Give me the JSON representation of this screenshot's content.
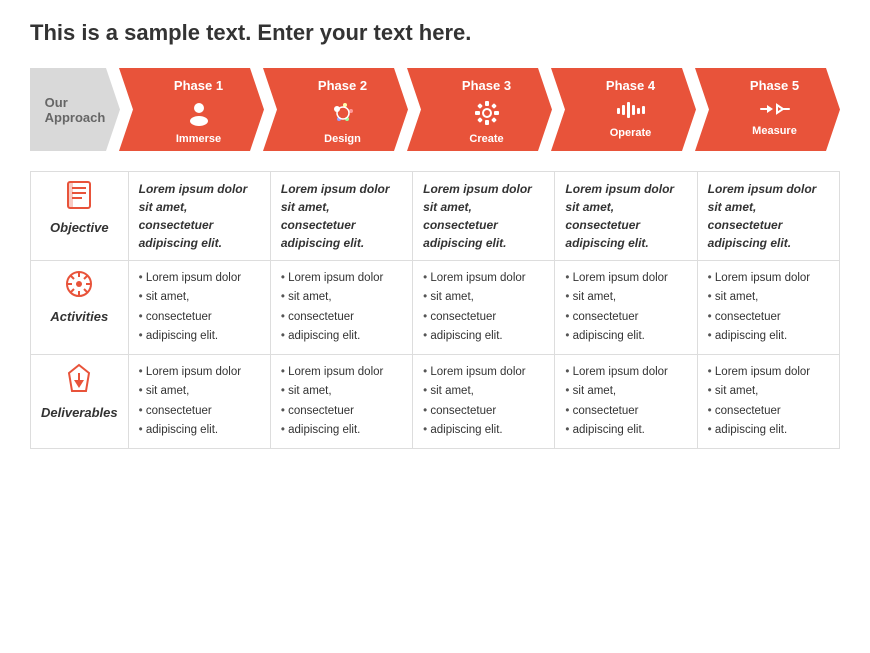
{
  "title": "This is a sample text. Enter your text here.",
  "approach_label": "Our\nApproach",
  "phases": [
    {
      "name": "Phase 1",
      "icon": "👤",
      "sub": "Immerse"
    },
    {
      "name": "Phase 2",
      "icon": "🎨",
      "sub": "Design"
    },
    {
      "name": "Phase 3",
      "icon": "⚙",
      "sub": "Create"
    },
    {
      "name": "Phase 4",
      "icon": "📊",
      "sub": "Operate"
    },
    {
      "name": "Phase 5",
      "icon": "⟺",
      "sub": "Measure"
    }
  ],
  "rows": [
    {
      "label": "Objective",
      "icon_char": "📋",
      "type": "objective",
      "cells": [
        "Lorem ipsum dolor sit amet, consectetuer adipiscing elit.",
        "Lorem ipsum dolor sit amet, consectetuer adipiscing elit.",
        "Lorem ipsum dolor sit amet, consectetuer adipiscing elit.",
        "Lorem ipsum dolor sit amet, consectetuer adipiscing elit.",
        "Lorem ipsum dolor sit amet, consectetuer adipiscing elit."
      ]
    },
    {
      "label": "Activities",
      "icon_char": "✦",
      "type": "bullets",
      "cells": [
        [
          "Lorem ipsum dolor",
          "sit amet,",
          "consectetuer",
          "adipiscing elit."
        ],
        [
          "Lorem ipsum dolor",
          "sit amet,",
          "consectetuer",
          "adipiscing elit."
        ],
        [
          "Lorem ipsum dolor",
          "sit amet,",
          "consectetuer",
          "adipiscing elit."
        ],
        [
          "Lorem ipsum dolor",
          "sit amet,",
          "consectetuer",
          "adipiscing elit."
        ],
        [
          "Lorem ipsum dolor",
          "sit amet,",
          "consectetuer",
          "adipiscing elit."
        ]
      ]
    },
    {
      "label": "Deliverables",
      "icon_char": "⏳",
      "type": "bullets",
      "cells": [
        [
          "Lorem ipsum dolor",
          "sit amet,",
          "consectetuer",
          "adipiscing elit."
        ],
        [
          "Lorem ipsum dolor",
          "sit amet,",
          "consectetuer",
          "adipiscing elit."
        ],
        [
          "Lorem ipsum dolor",
          "sit amet,",
          "consectetuer",
          "adipiscing elit."
        ],
        [
          "Lorem ipsum dolor",
          "sit amet,",
          "consectetuer",
          "adipiscing elit."
        ],
        [
          "Lorem ipsum dolor",
          "sit amet,",
          "consectetuer",
          "adipiscing elit."
        ]
      ]
    }
  ],
  "colors": {
    "orange": "#e8533a",
    "gray_bg": "#d9d9d9",
    "text_dark": "#333333",
    "border": "#dddddd"
  }
}
